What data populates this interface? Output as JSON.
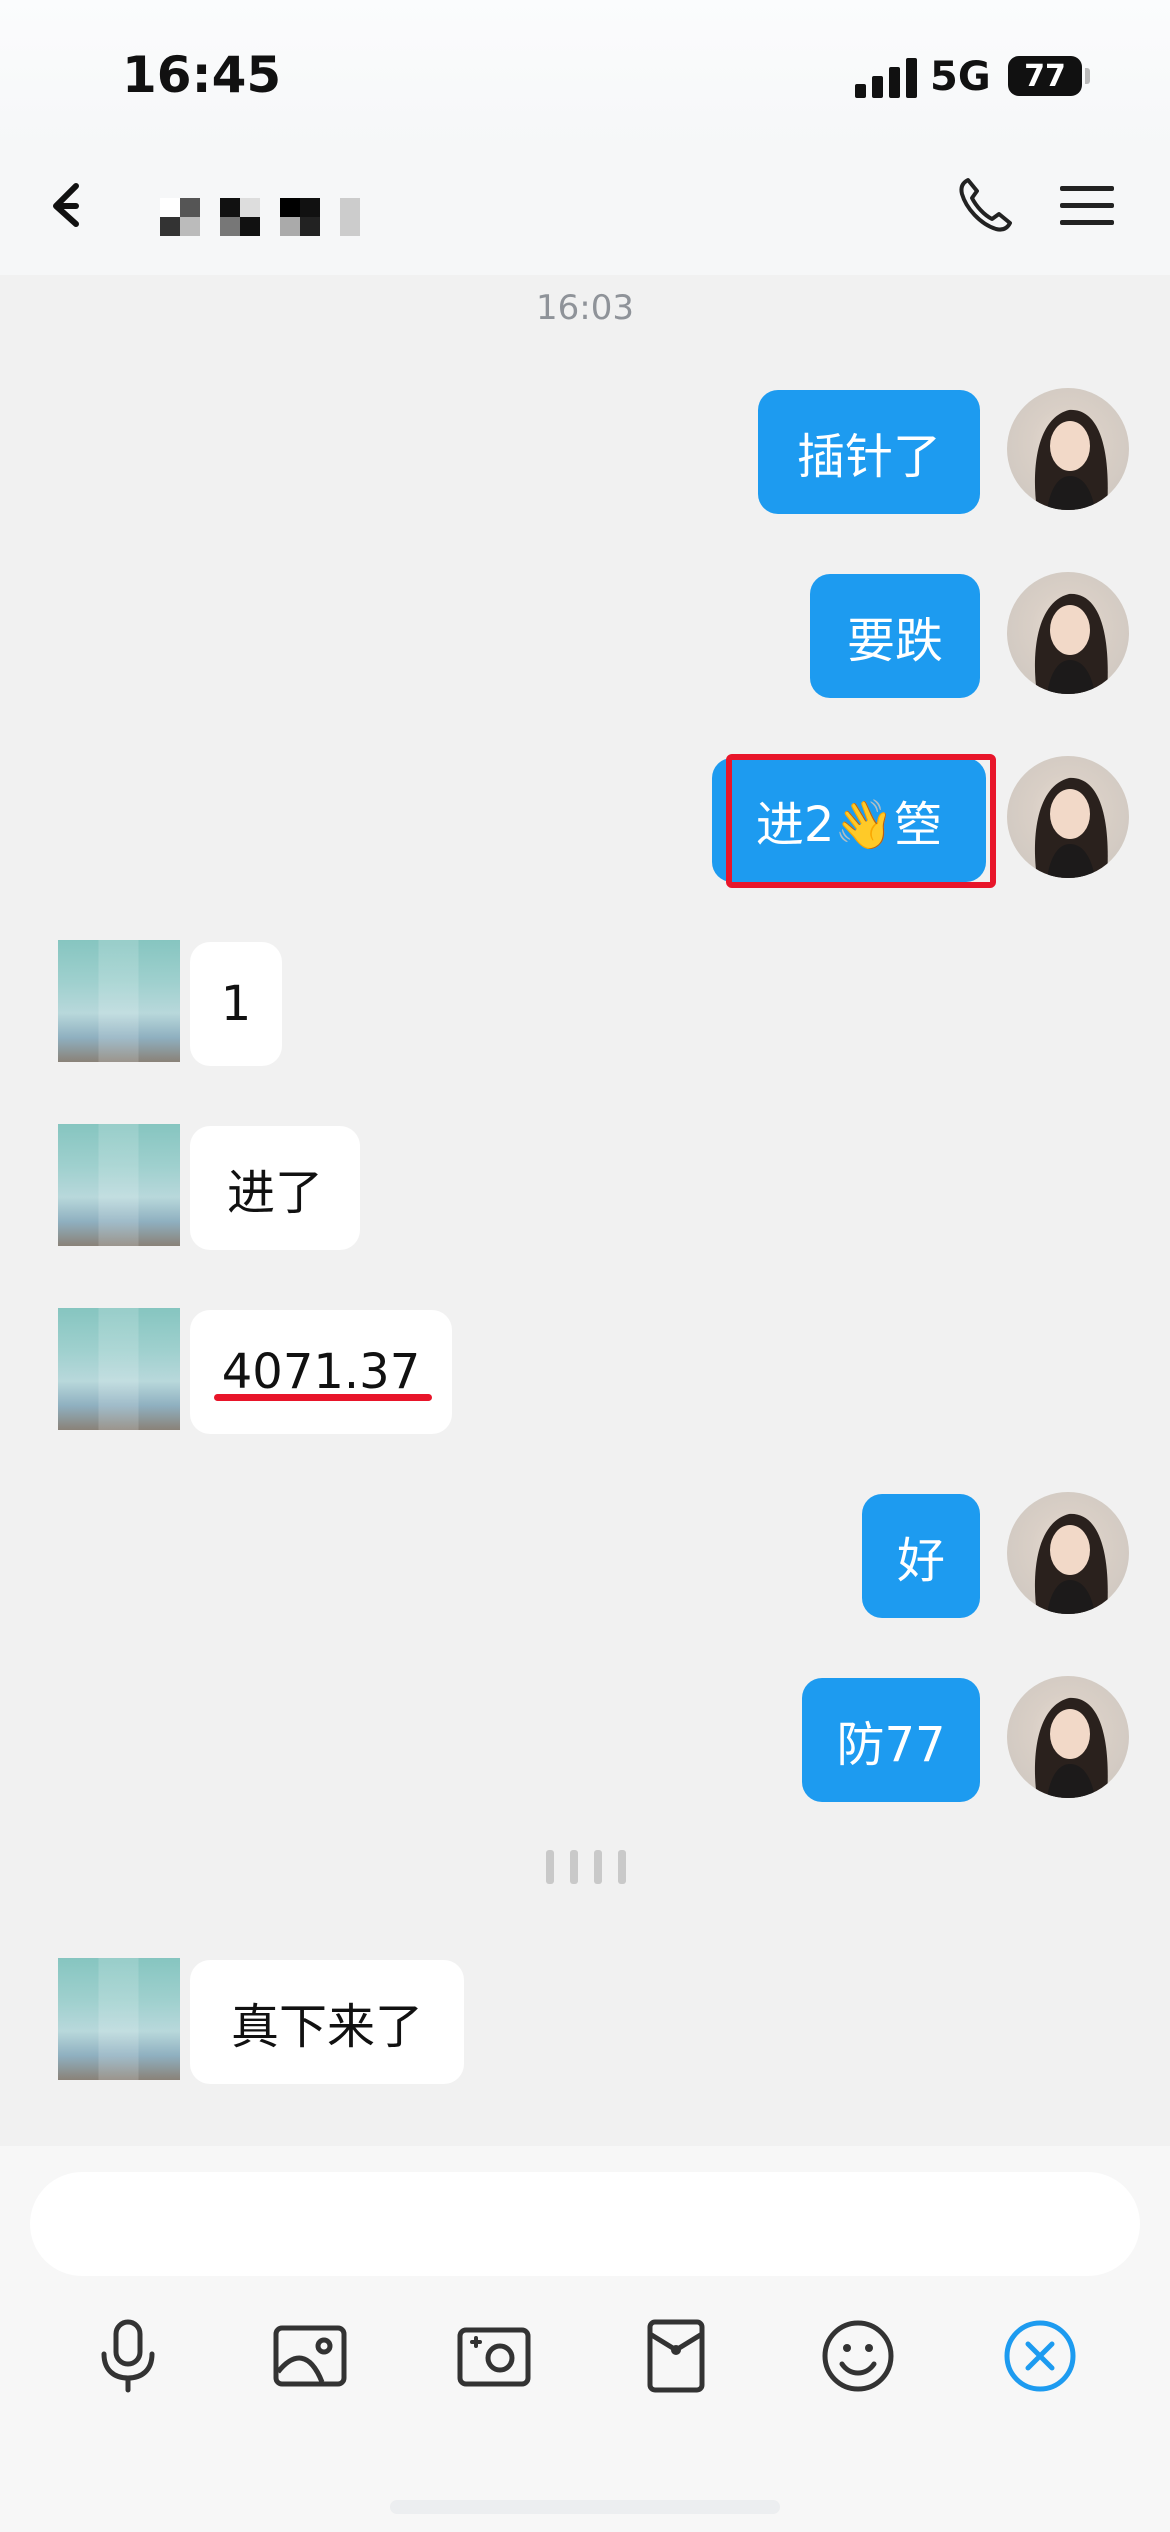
{
  "status_bar": {
    "time": "16:45",
    "network": "5G",
    "battery": "77"
  },
  "header": {
    "contact_name_pixelated": "",
    "back_icon": "back-chevron-icon",
    "call_icon": "phone-icon",
    "menu_icon": "menu-icon"
  },
  "chat": {
    "timestamp": "16:03",
    "messages": [
      {
        "sender": "me",
        "text": "插针了"
      },
      {
        "sender": "me",
        "text": "要跌"
      },
      {
        "sender": "me",
        "text": "进2👋箜",
        "highlighted": true
      },
      {
        "sender": "them",
        "text": "1"
      },
      {
        "sender": "them",
        "text": "进了"
      },
      {
        "sender": "them",
        "text": "4071.37",
        "underlined": true
      },
      {
        "sender": "me",
        "text": "好"
      },
      {
        "sender": "me",
        "text": "防77"
      },
      {
        "sender": "them",
        "text": "真下来了"
      }
    ]
  },
  "input": {
    "placeholder": ""
  },
  "toolbar": {
    "icons": [
      "microphone-icon",
      "image-icon",
      "camera-icon",
      "red-packet-icon",
      "emoji-icon",
      "close-circle-icon"
    ]
  },
  "colors": {
    "accent": "#1d9bf0",
    "highlight": "#e8152a",
    "background": "#f1f1f1"
  }
}
